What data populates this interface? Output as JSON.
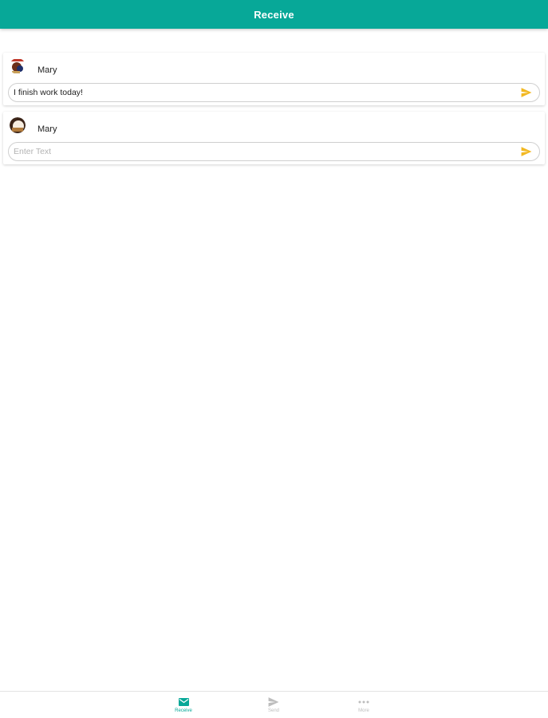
{
  "appbar": {
    "title": "Receive"
  },
  "colors": {
    "primary": "#07a898",
    "send_icon": "#f2b822",
    "inactive": "#bdbdbd"
  },
  "messages": [
    {
      "sender": "Mary",
      "input_value": "I finish work today!",
      "input_placeholder": "Enter Text",
      "send_icon": "send-icon"
    },
    {
      "sender": "Mary",
      "input_value": "",
      "input_placeholder": "Enter Text",
      "send_icon": "send-icon"
    }
  ],
  "bottom_nav": {
    "items": [
      {
        "label": "Receive",
        "icon": "mail-icon",
        "active": true
      },
      {
        "label": "Send",
        "icon": "send-icon",
        "active": false
      },
      {
        "label": "More",
        "icon": "more-icon",
        "active": false
      }
    ]
  }
}
